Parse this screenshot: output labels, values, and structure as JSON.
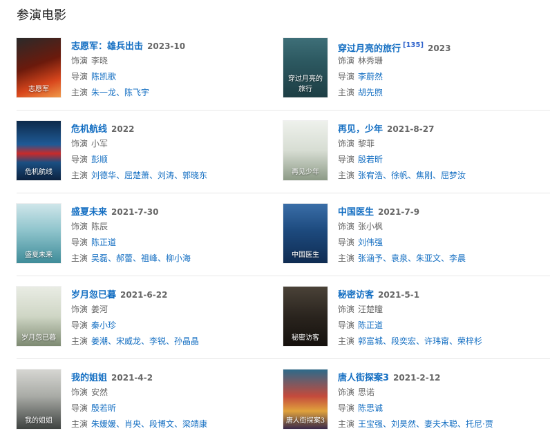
{
  "section_title": "参演电影",
  "labels": {
    "role": "饰演",
    "director": "导演",
    "cast": "主演"
  },
  "movies": [
    {
      "title": "志愿军：雄兵出击",
      "ref": "",
      "date": "2023-10",
      "role": "李晓",
      "director": "陈凯歌",
      "cast": "朱一龙、陈飞宇",
      "poster": {
        "text": "志愿军",
        "bg": "linear-gradient(160deg,#2a2a2a 0%,#6b1a0c 45%,#d8461c 75%,#f09a4a 100%)"
      }
    },
    {
      "title": "穿过月亮的旅行",
      "ref": "[135]",
      "date": "2023",
      "role": "林秀珊",
      "director": "李蔚然",
      "cast": "胡先煦",
      "poster": {
        "text": "穿过月亮的旅行",
        "bg": "linear-gradient(180deg,#3e6f78 0%,#2c5860 40%,#1d3e44 100%)"
      }
    },
    {
      "title": "危机航线",
      "ref": "",
      "date": "2022",
      "role": "小军",
      "director": "彭顺",
      "cast": "刘德华、屈楚萧、刘涛、郭晓东",
      "poster": {
        "text": "危机航线",
        "bg": "linear-gradient(180deg,#0d2a4a 0%,#1f5a96 40%,#c92a2a 55%,#1b4f82 70%,#0c2240 100%)"
      }
    },
    {
      "title": "再见，少年",
      "ref": "",
      "date": "2021-8-27",
      "role": "黎菲",
      "director": "殷若昕",
      "cast": "张宥浩、徐帆、焦刚、屈梦汝",
      "poster": {
        "text": "再见少年",
        "bg": "linear-gradient(180deg,#eef1ec 0%,#d7ddd3 50%,#8c9a86 100%)"
      }
    },
    {
      "title": "盛夏未来",
      "ref": "",
      "date": "2021-7-30",
      "role": "陈辰",
      "director": "陈正道",
      "cast": "吴磊、郝蕾、祖峰、柳小海",
      "poster": {
        "text": "盛夏未来",
        "bg": "linear-gradient(180deg,#cfe6ea 0%,#8fc4cc 45%,#3f8c99 100%)"
      }
    },
    {
      "title": "中国医生",
      "ref": "",
      "date": "2021-7-9",
      "role": "张小枫",
      "director": "刘伟强",
      "cast": "张涵予、袁泉、朱亚文、李晨",
      "poster": {
        "text": "中国医生",
        "bg": "linear-gradient(180deg,#3a6ea8 0%,#1d4a7e 45%,#0f2c52 100%)"
      }
    },
    {
      "title": "岁月忽已暮",
      "ref": "",
      "date": "2021-6-22",
      "role": "姜河",
      "director": "秦小珍",
      "cast": "姜潮、宋威龙、李锐、孙晶晶",
      "poster": {
        "text": "岁月忽已暮",
        "bg": "linear-gradient(180deg,#e9ece4 0%,#cfd6c5 50%,#7d8a72 100%)"
      }
    },
    {
      "title": "秘密访客",
      "ref": "",
      "date": "2021-5-1",
      "role": "汪楚瞳",
      "director": "陈正道",
      "cast": "郭富城、段奕宏、许玮甯、荣梓杉",
      "poster": {
        "text": "秘密访客",
        "bg": "linear-gradient(180deg,#4a4238 0%,#2a241e 50%,#15110d 100%)"
      }
    },
    {
      "title": "我的姐姐",
      "ref": "",
      "date": "2021-4-2",
      "role": "安然",
      "director": "殷若昕",
      "cast": "朱媛媛、肖央、段博文、梁靖康",
      "poster": {
        "text": "我的姐姐",
        "bg": "linear-gradient(180deg,#d6d6d2 0%,#a9aba6 45%,#3e4240 100%)"
      }
    },
    {
      "title": "唐人街探案3",
      "ref": "",
      "date": "2021-2-12",
      "role": "思诺",
      "director": "陈思诚",
      "cast": "王宝强、刘昊然、妻夫木聪、托尼·贾",
      "poster": {
        "text": "唐人街探案3",
        "bg": "linear-gradient(180deg,#2d6a8a 0%,#c44a3c 45%,#e0a23c 70%,#3a2a4a 100%)"
      }
    }
  ]
}
